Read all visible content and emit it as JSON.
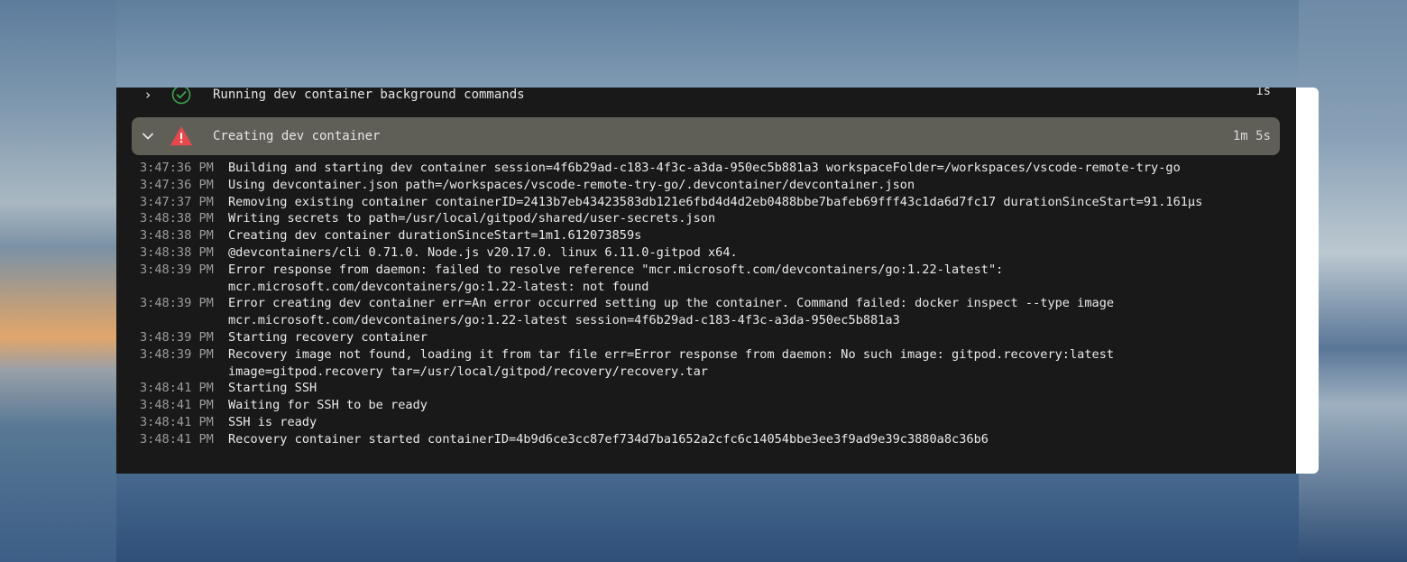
{
  "steps": [
    {
      "chevron": "›",
      "status": "success",
      "label": "Running dev container background commands",
      "duration": "1s"
    },
    {
      "chevron": "⌄",
      "status": "error",
      "label": "Creating dev container",
      "duration": "1m 5s"
    }
  ],
  "log": [
    {
      "time": "3:47:36 PM",
      "lines": [
        "Building and starting dev container session=4f6b29ad-c183-4f3c-a3da-950ec5b881a3 workspaceFolder=/workspaces/vscode-remote-try-go"
      ]
    },
    {
      "time": "3:47:36 PM",
      "lines": [
        "Using devcontainer.json path=/workspaces/vscode-remote-try-go/.devcontainer/devcontainer.json"
      ]
    },
    {
      "time": "3:47:37 PM",
      "lines": [
        "Removing existing container containerID=2413b7eb43423583db121e6fbd4d4d2eb0488bbe7bafeb69fff43c1da6d7fc17 durationSinceStart=91.161µs"
      ]
    },
    {
      "time": "3:48:38 PM",
      "lines": [
        "Writing secrets to path=/usr/local/gitpod/shared/user-secrets.json"
      ]
    },
    {
      "time": "3:48:38 PM",
      "lines": [
        "Creating dev container durationSinceStart=1m1.612073859s"
      ]
    },
    {
      "time": "3:48:38 PM",
      "lines": [
        "@devcontainers/cli 0.71.0. Node.js v20.17.0. linux 6.11.0-gitpod x64."
      ]
    },
    {
      "time": "3:48:39 PM",
      "lines": [
        "Error response from daemon: failed to resolve reference \"mcr.microsoft.com/devcontainers/go:1.22-latest\":",
        "mcr.microsoft.com/devcontainers/go:1.22-latest: not found"
      ]
    },
    {
      "time": "3:48:39 PM",
      "lines": [
        "Error creating dev container err=An error occurred setting up the container. Command failed: docker inspect --type image",
        "mcr.microsoft.com/devcontainers/go:1.22-latest session=4f6b29ad-c183-4f3c-a3da-950ec5b881a3"
      ]
    },
    {
      "time": "3:48:39 PM",
      "lines": [
        "Starting recovery container"
      ]
    },
    {
      "time": "3:48:39 PM",
      "lines": [
        "Recovery image not found, loading it from tar file err=Error response from daemon: No such image: gitpod.recovery:latest",
        "image=gitpod.recovery tar=/usr/local/gitpod/recovery/recovery.tar"
      ]
    },
    {
      "time": "3:48:41 PM",
      "lines": [
        "Starting SSH"
      ]
    },
    {
      "time": "3:48:41 PM",
      "lines": [
        "Waiting for SSH to be ready"
      ]
    },
    {
      "time": "3:48:41 PM",
      "lines": [
        "SSH is ready"
      ]
    },
    {
      "time": "3:48:41 PM",
      "lines": [
        "Recovery container started containerID=4b9d6ce3cc87ef734d7ba1652a2cfc6c14054bbe3ee3f9ad9e39c3880a8c36b6"
      ]
    }
  ],
  "colors": {
    "success": "#3fa34d",
    "error": "#e5484d"
  }
}
